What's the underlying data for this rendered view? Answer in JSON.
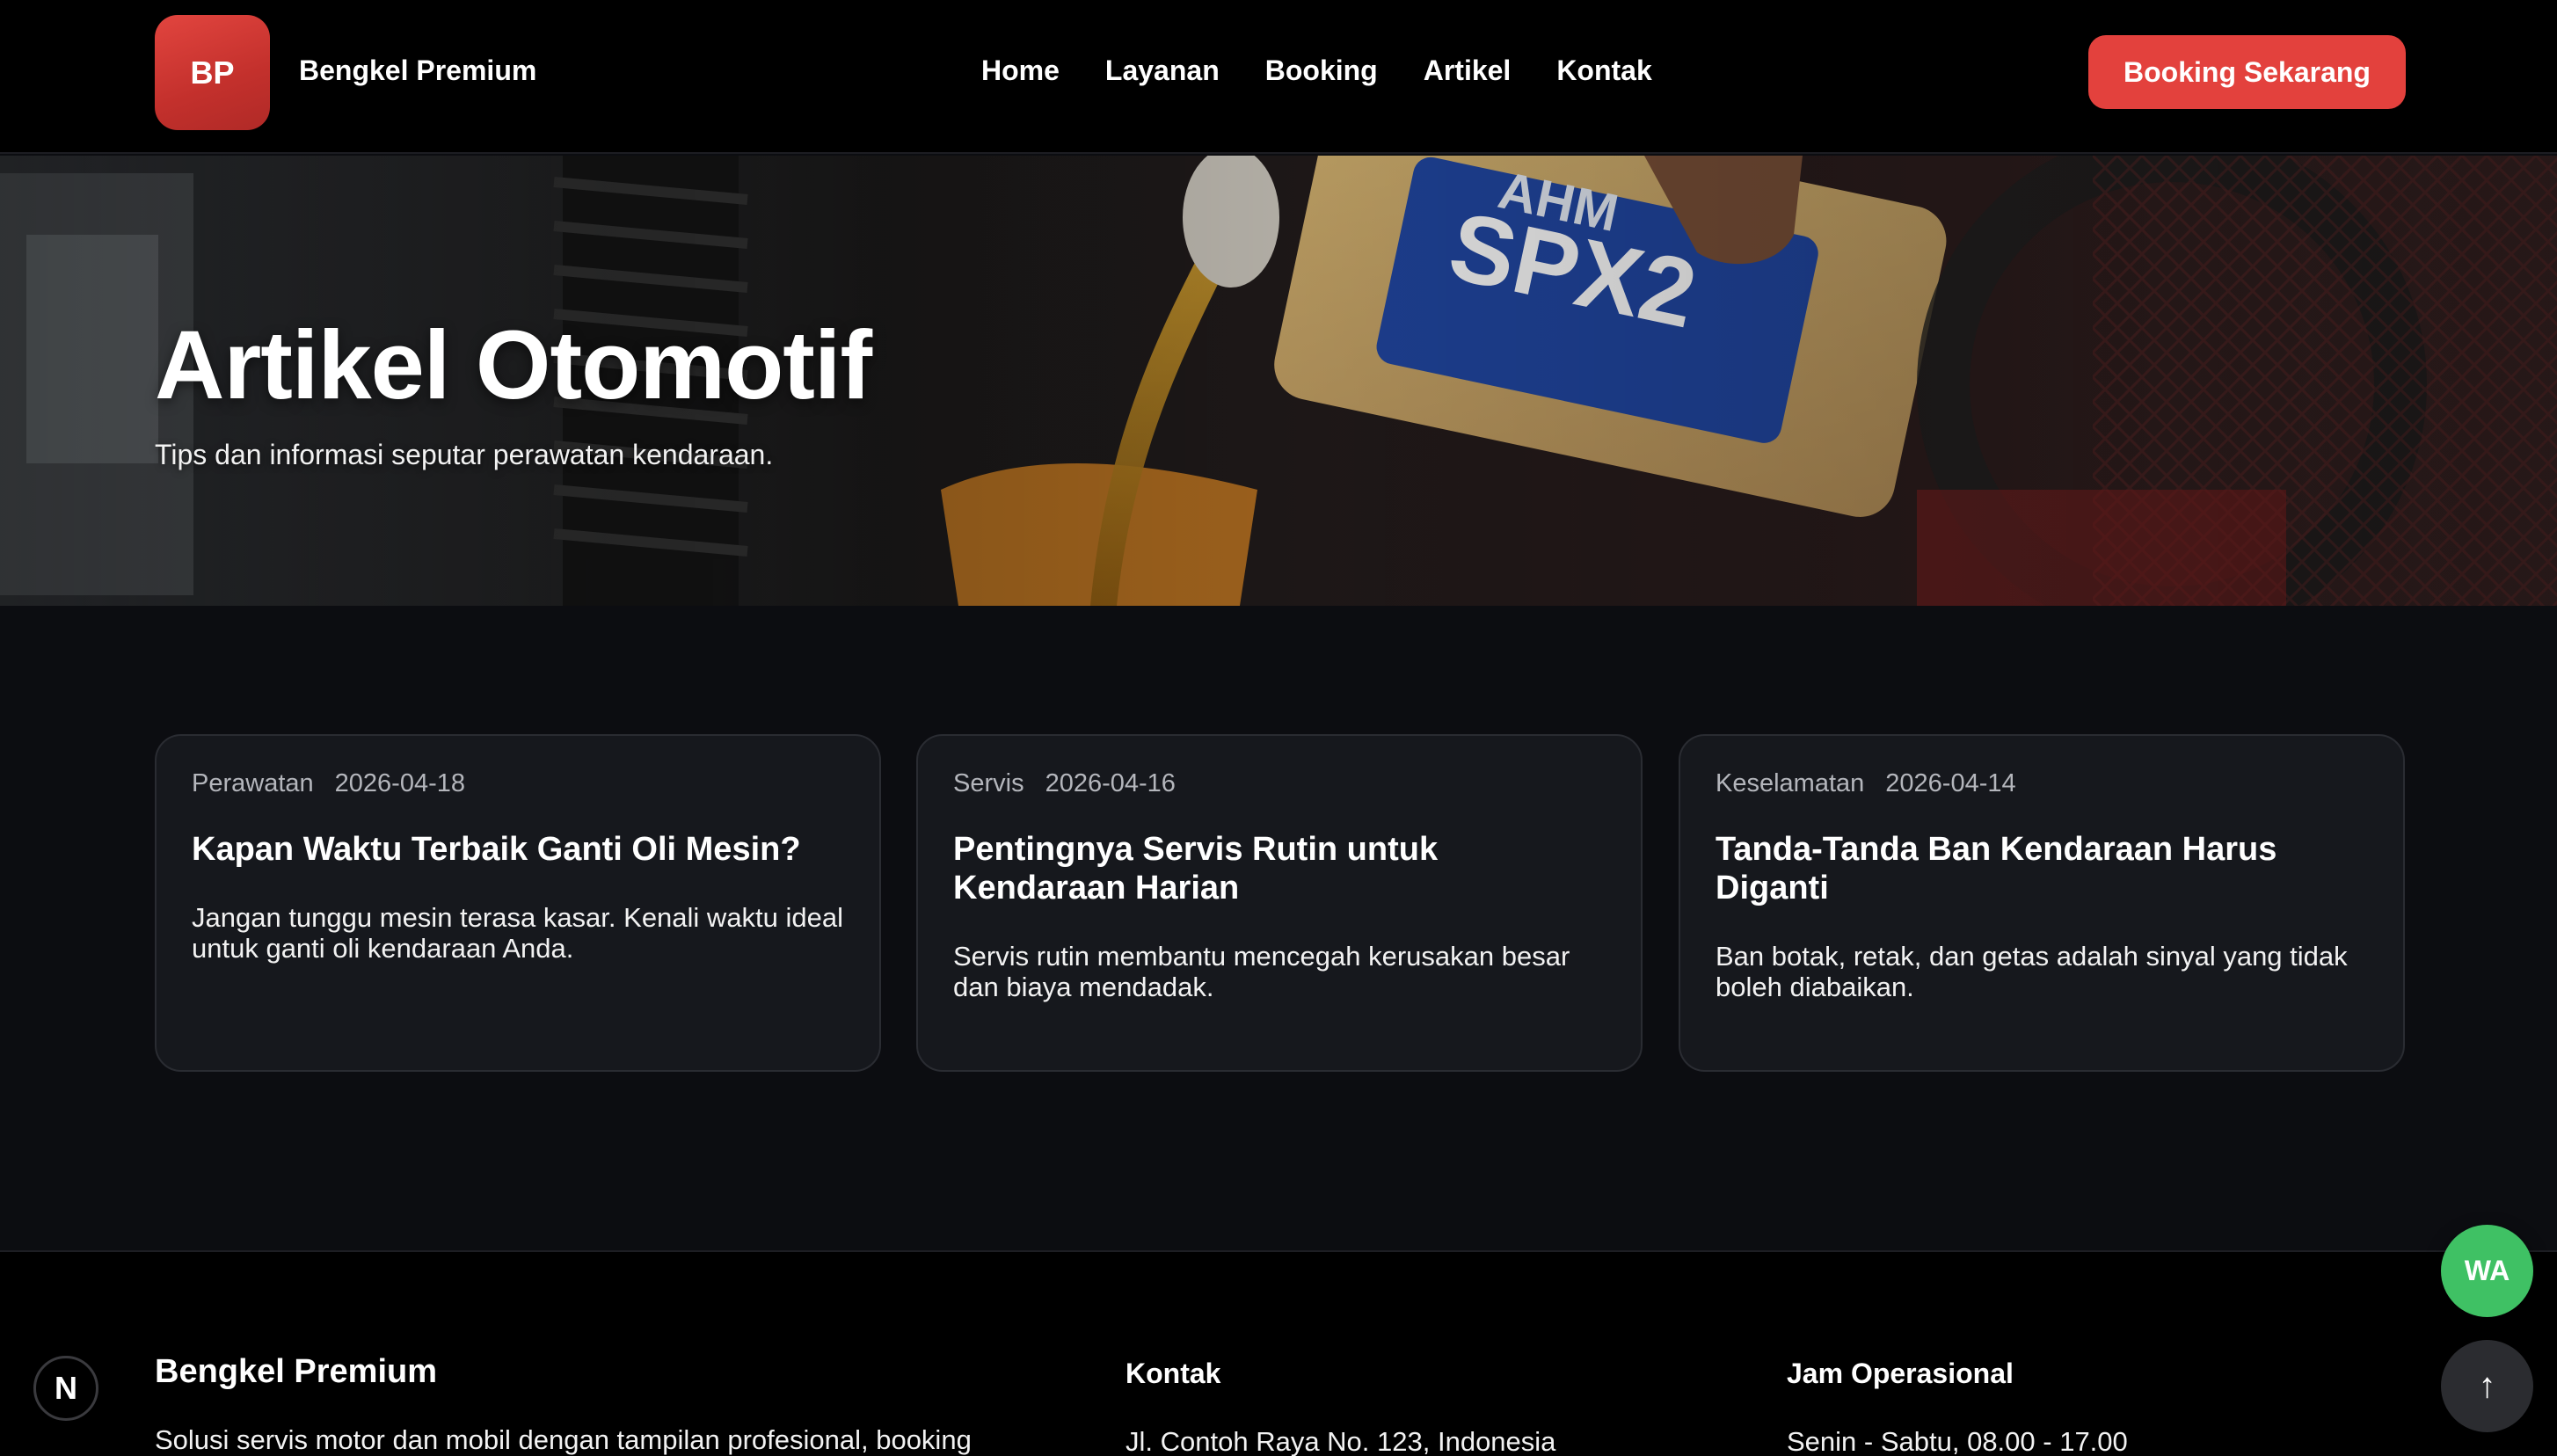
{
  "header": {
    "logo_text": "BP",
    "brand": "Bengkel Premium",
    "nav": [
      "Home",
      "Layanan",
      "Booking",
      "Artikel",
      "Kontak"
    ],
    "cta": "Booking Sekarang"
  },
  "hero": {
    "title": "Artikel Otomotif",
    "subtitle": "Tips dan informasi seputar perawatan kendaraan.",
    "image_text": "AHM SPX2"
  },
  "articles": [
    {
      "category": "Perawatan",
      "date": "2026-04-18",
      "title": "Kapan Waktu Terbaik Ganti Oli Mesin?",
      "excerpt": "Jangan tunggu mesin terasa kasar. Kenali waktu ideal untuk ganti oli kendaraan Anda."
    },
    {
      "category": "Servis",
      "date": "2026-04-16",
      "title": "Pentingnya Servis Rutin untuk Kendaraan Harian",
      "excerpt": "Servis rutin membantu mencegah kerusakan besar dan biaya mendadak."
    },
    {
      "category": "Keselamatan",
      "date": "2026-04-14",
      "title": "Tanda-Tanda Ban Kendaraan Harus Diganti",
      "excerpt": "Ban botak, retak, dan getas adalah sinyal yang tidak boleh diabaikan."
    }
  ],
  "footer": {
    "brand": "Bengkel Premium",
    "description": "Solusi servis motor dan mobil dengan tampilan profesional, booking",
    "contact_heading": "Kontak",
    "address": "Jl. Contoh Raya No. 123, Indonesia",
    "hours_heading": "Jam Operasional",
    "hours": "Senin - Sabtu, 08.00 - 17.00"
  },
  "floating": {
    "whatsapp_label": "WA",
    "scroll_top_label": "↑",
    "dev_badge": "N"
  },
  "colors": {
    "accent": "#e3413d",
    "whatsapp": "#3fc164",
    "page_bg": "#0c0d11",
    "card_bg": "#16181d"
  }
}
